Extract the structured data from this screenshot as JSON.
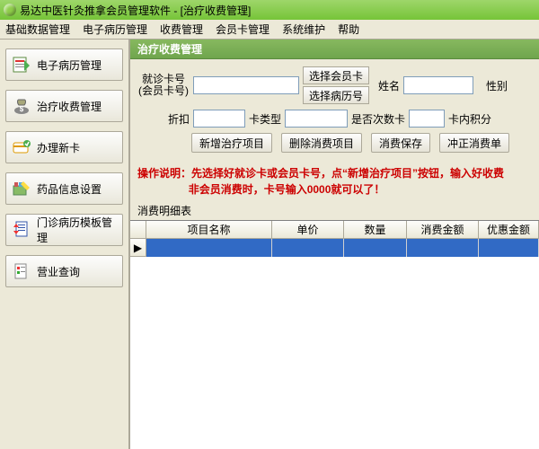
{
  "app": {
    "title": "易达中医针灸推拿会员管理软件 - [治疗收费管理]"
  },
  "menu": {
    "items": [
      "基础数据管理",
      "电子病历管理",
      "收费管理",
      "会员卡管理",
      "系统维护",
      "帮助"
    ]
  },
  "sidebar": {
    "items": [
      {
        "label": "电子病历管理"
      },
      {
        "label": "治疗收费管理"
      },
      {
        "label": "办理新卡"
      },
      {
        "label": "药品信息设置"
      },
      {
        "label": "门诊病历模板管理"
      },
      {
        "label": "营业查询"
      }
    ]
  },
  "panel": {
    "title": "治疗收费管理"
  },
  "form": {
    "card_label1": "就诊卡号",
    "card_label2": "(会员卡号)",
    "select_member": "选择会员卡",
    "select_record": "选择病历号",
    "name_label": "姓名",
    "gender_label": "性别",
    "discount_label": "折扣",
    "cardtype_label": "卡类型",
    "is_count_label": "是否次数卡",
    "points_label": "卡内积分"
  },
  "buttons": {
    "add": "新增治疗项目",
    "del": "删除消费项目",
    "save": "消费保存",
    "reverse": "冲正消费单"
  },
  "instruction": {
    "prefix": "操作说明：",
    "line1": "先选择好就诊卡或会员卡号，点“新增治疗项目”按钮，输入好收费",
    "line2": "非会员消费时，卡号输入0000就可以了！"
  },
  "grid": {
    "caption": "消费明细表",
    "columns": [
      "项目名称",
      "单价",
      "数量",
      "消费金额",
      "优惠金额"
    ]
  }
}
